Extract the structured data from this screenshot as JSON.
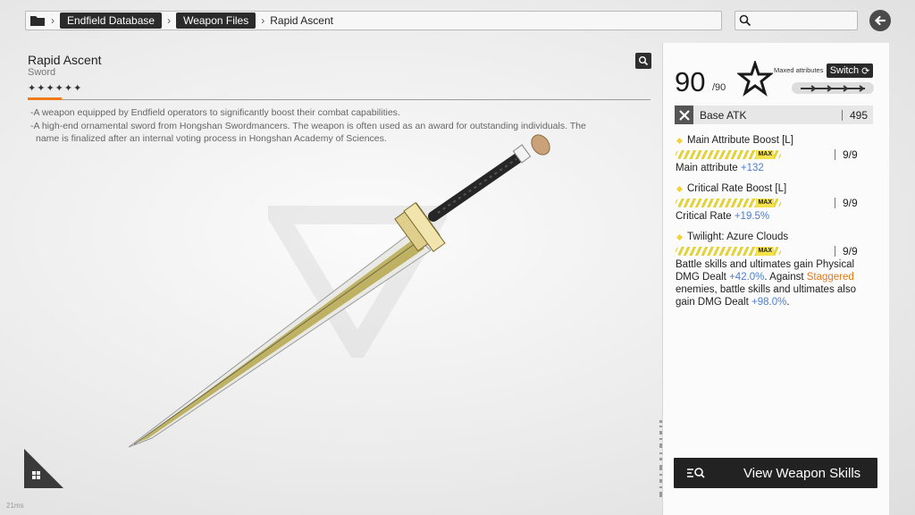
{
  "breadcrumb": {
    "items": [
      "Endfield Database",
      "Weapon Files"
    ],
    "current": "Rapid Ascent",
    "folder_icon": "folder-icon"
  },
  "search": {
    "icon": "search-icon"
  },
  "weapon": {
    "name": "Rapid Ascent",
    "type": "Sword",
    "rarity_stars": 6,
    "description": [
      "A weapon equipped by Endfield operators to significantly boost their combat capabilities.",
      "A high-end ornamental sword from Hongshan Swordmancers. The weapon is often used as an award for outstanding individuals. The name is finalized after an internal voting process in Hongshan Academy of Sciences."
    ]
  },
  "panel": {
    "level": "90",
    "level_max": "/90",
    "maxed_label": "Maxed attributes",
    "switch_label": "Switch",
    "base_atk_label": "Base ATK",
    "base_atk_value": "495",
    "attributes": [
      {
        "title": "Main Attribute Boost [L]",
        "max_label": "MAX",
        "level": "9/9",
        "stat_label": "Main attribute ",
        "stat_value": "+132"
      },
      {
        "title": "Critical Rate Boost [L]",
        "max_label": "MAX",
        "level": "9/9",
        "stat_label": "Critical Rate ",
        "stat_value": "+19.5%"
      },
      {
        "title": "Twilight: Azure Clouds",
        "max_label": "MAX",
        "level": "9/9",
        "effect_part1": "Battle skills and ultimates gain Physical DMG Dealt ",
        "effect_value1": "+42.0%",
        "effect_part2_pre": "Against ",
        "effect_keyword": "Staggered",
        "effect_part2_post": " enemies, battle skills and ultimates also gain DMG Dealt ",
        "effect_value2": "+98.0%"
      }
    ],
    "skills_button": "View Weapon Skills"
  },
  "footer": {
    "ms": "21ms"
  },
  "colors": {
    "accent_orange": "#f07a1a",
    "stat_blue": "#4a7fd4",
    "max_yellow": "#e4d23c",
    "dark": "#222222"
  }
}
